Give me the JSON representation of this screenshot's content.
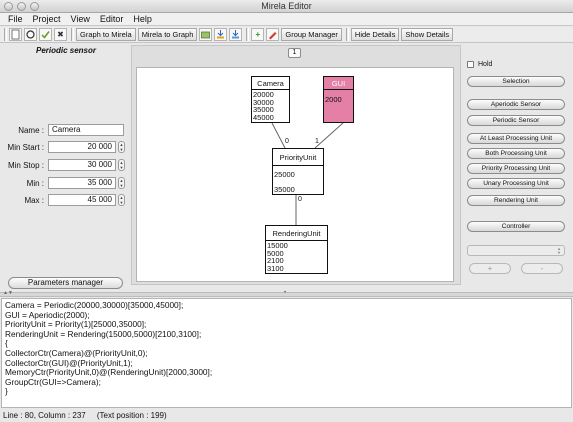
{
  "window": {
    "title": "Mirela Editor"
  },
  "menubar": {
    "items": [
      "File",
      "Project",
      "View",
      "Editor",
      "Help"
    ]
  },
  "toolbar": {
    "graph_to_mirela": "Graph to Mirela",
    "mirela_to_graph": "Mirela to Graph",
    "group_manager": "Group Manager",
    "hide_details": "Hide Details",
    "show_details": "Show Details",
    "icons": [
      "new-file-icon",
      "open-icon",
      "save-icon",
      "close-x-icon",
      "import-icon",
      "export-a-icon",
      "export-b-icon",
      "add-plus-icon",
      "delete-icon"
    ]
  },
  "left_panel": {
    "title": "Periodic sensor",
    "fields": [
      {
        "label": "Name :",
        "value": "Camera",
        "align": "left"
      },
      {
        "label": "Min Start :",
        "value": "20 000",
        "align": "right"
      },
      {
        "label": "Min Stop :",
        "value": "30 000",
        "align": "right"
      },
      {
        "label": "Min :",
        "value": "35 000",
        "align": "right"
      },
      {
        "label": "Max :",
        "value": "45 000",
        "align": "right"
      }
    ],
    "params_button": "Parameters manager"
  },
  "canvas": {
    "tab_label": "1",
    "nodes": [
      {
        "id": "camera",
        "name": "Camera",
        "values": [
          "20000",
          "30000",
          "35000",
          "45000"
        ],
        "highlight": false
      },
      {
        "id": "gui",
        "name": "GUI",
        "values": [
          "2000"
        ],
        "highlight": true,
        "color": "#e47fa6"
      },
      {
        "id": "priority",
        "name": "PriorityUnit",
        "values": [
          "25000",
          "35000"
        ],
        "highlight": false
      },
      {
        "id": "rendering",
        "name": "RenderingUnit",
        "values": [
          "15000",
          "5000",
          "2100",
          "3100"
        ],
        "highlight": false
      }
    ],
    "edge_labels": [
      "0",
      "1",
      "0"
    ]
  },
  "right_panel": {
    "hold_label": "Hold",
    "buttons": [
      "Selection",
      "Aperiodic Sensor",
      "Periodic Sensor",
      "At Least Processing Unit",
      "Both Processing Unit",
      "Priority Processing Unit",
      "Unary Processing Unit",
      "Rendering Unit",
      "Controller"
    ],
    "plus_label": "+",
    "minus_label": "-"
  },
  "code": {
    "lines": [
      "Camera = Periodic(20000,30000)[35000,45000];",
      "GUI = Aperiodic(2000);",
      "PriorityUnit = Priority(1)[25000,35000];",
      "RenderingUnit = Rendering(15000,5000)[2100,3100];",
      "{",
      "CollectorCtr(Camera)@(PriorityUnit,0);",
      "CollectorCtr(GUI)@(PriorityUnit,1);",
      "MemoryCtr(PriorityUnit,0)@(RenderingUnit)[2000,3000];",
      "GroupCtr(GUI=>Camera);",
      "}"
    ]
  },
  "status": {
    "text": "Line : 80, Column : 237     (Text position : 199)"
  }
}
